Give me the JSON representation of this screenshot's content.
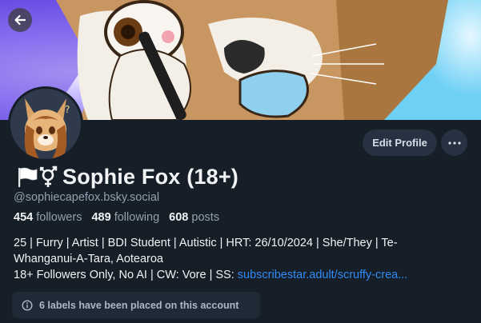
{
  "header": {
    "back_icon": "arrow-left-icon",
    "banner": "fox character holding pen with blue speech-bubble tongue"
  },
  "profile": {
    "flag_emojis": "🏳️⚧",
    "display_name": "Sophie Fox (18+)",
    "handle": "@sophiecapefox.bsky.social",
    "followers_count": "454",
    "followers_label": "followers",
    "following_count": "489",
    "following_label": "following",
    "posts_count": "608",
    "posts_label": "posts"
  },
  "actions": {
    "edit_profile": "Edit Profile",
    "more_icon": "ellipsis-icon"
  },
  "bio": {
    "line1": "25 | Furry | Artist | BDI Student | Autistic | HRT: 26/10/2024 | She/They | Te-",
    "line2": "Whanganui-A-Tara, Aotearoa",
    "line3_prefix": "18+ Followers Only, No AI | CW: Vore | SS: ",
    "line3_link": "subscribestar.adult/scruffy-crea..."
  },
  "labels_notice": {
    "text": "6 labels have been placed on this account",
    "icon": "info-icon"
  },
  "colors": {
    "background": "#161e27",
    "link": "#2f8bf5",
    "muted": "#93a0b0",
    "button_bg": "#263241"
  }
}
